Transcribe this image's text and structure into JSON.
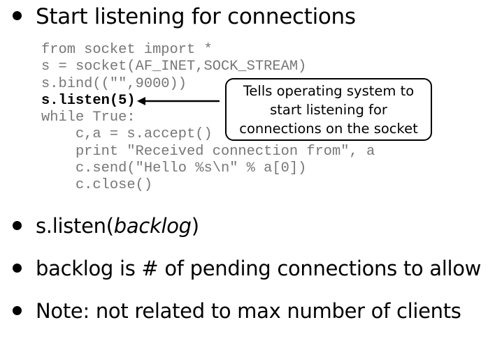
{
  "title": "Start listening for connections",
  "code_lines": [
    "from socket import *",
    "s = socket(AF_INET,SOCK_STREAM)",
    "s.bind((\"\",9000))",
    "s.listen(5)",
    "while True:",
    "    c,a = s.accept()",
    "    print \"Received connection from\", a",
    "    c.send(\"Hello %s\\n\" % a[0])",
    "    c.close()"
  ],
  "callout": "Tells operating system to\nstart listening for\nconnections on the socket",
  "bullets": {
    "listen_prefix": "s.listen(",
    "listen_arg": "backlog",
    "listen_suffix": ")",
    "backlog": "backlog is # of pending connections to allow",
    "note": "Note: not related to max number of clients"
  }
}
